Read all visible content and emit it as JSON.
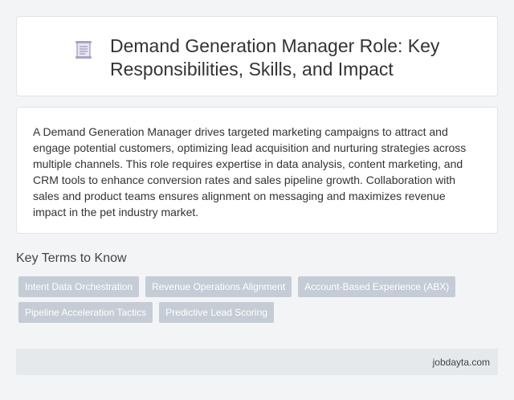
{
  "header": {
    "title": "Demand Generation Manager Role: Key Responsibilities, Skills, and Impact",
    "icon": "document-icon"
  },
  "description": {
    "text": "A Demand Generation Manager drives targeted marketing campaigns to attract and engage potential customers, optimizing lead acquisition and nurturing strategies across multiple channels. This role requires expertise in data analysis, content marketing, and CRM tools to enhance conversion rates and sales pipeline growth. Collaboration with sales and product teams ensures alignment on messaging and maximizes revenue impact in the pet industry market."
  },
  "key_terms": {
    "heading": "Key Terms to Know",
    "items": [
      "Intent Data Orchestration",
      "Revenue Operations Alignment",
      "Account-Based Experience (ABX)",
      "Pipeline Acceleration Tactics",
      "Predictive Lead Scoring"
    ]
  },
  "footer": {
    "site": "jobdayta.com"
  },
  "colors": {
    "background": "#f3f4f6",
    "card": "#ffffff",
    "chip": "#c6ccd6",
    "footer": "#e5e9ec"
  }
}
